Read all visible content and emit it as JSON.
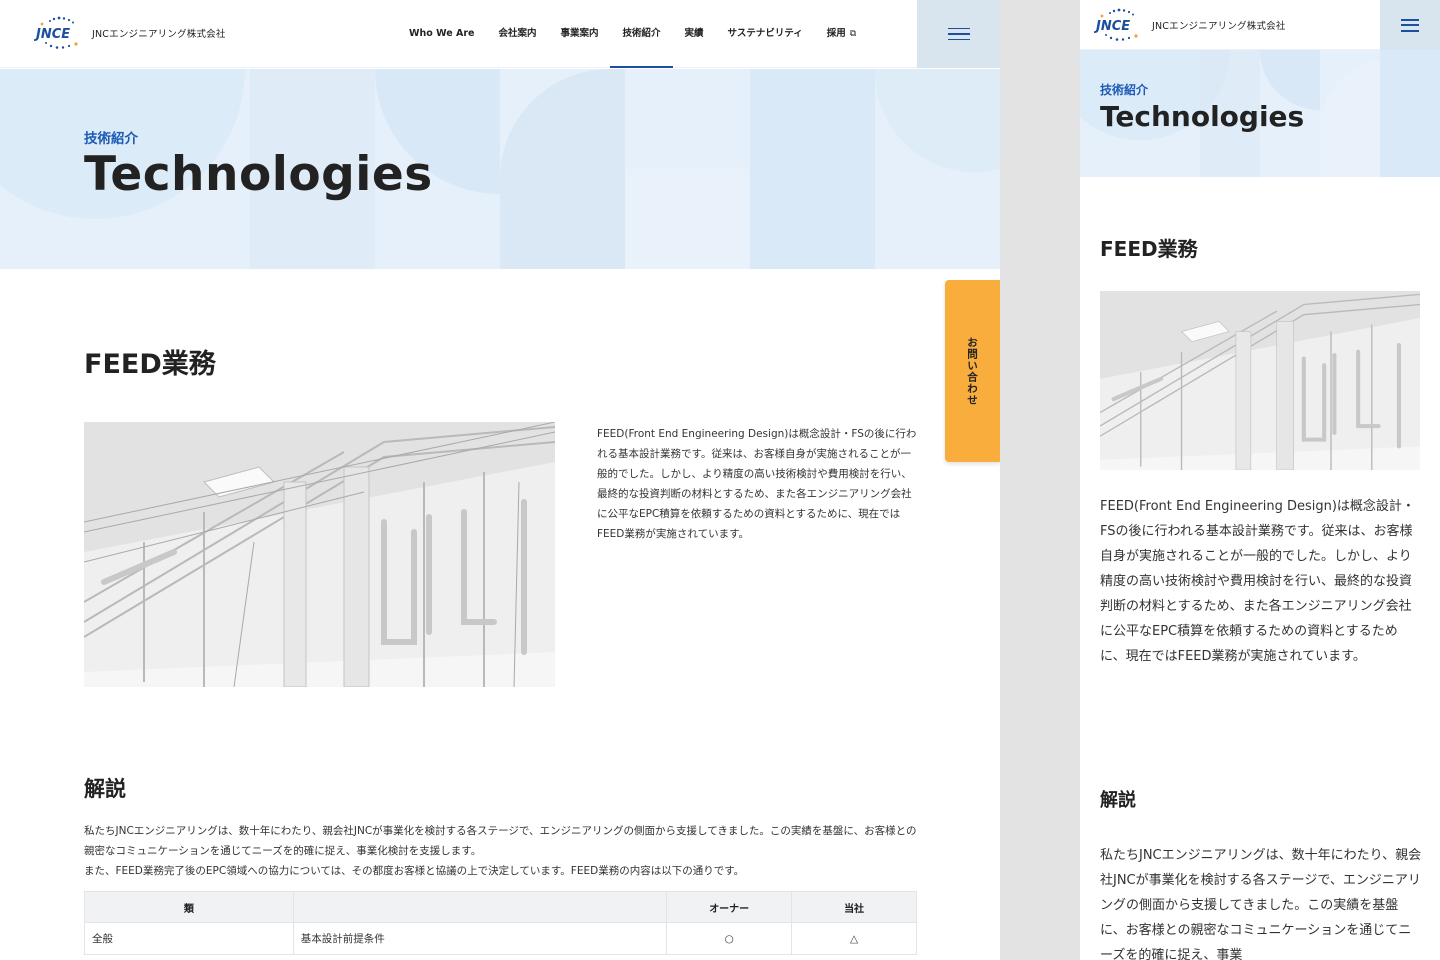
{
  "brand": {
    "company_name": "JNCエンジニアリング株式会社",
    "logo_text": "JNCE",
    "accent_color": "#1c4fa0",
    "hero_bg": "#e5f0fa",
    "contact_color": "#f8ad3d"
  },
  "nav": {
    "items": [
      {
        "label": "Who We Are"
      },
      {
        "label": "会社案内"
      },
      {
        "label": "事業案内"
      },
      {
        "label": "技術紹介",
        "active": true
      },
      {
        "label": "実績"
      },
      {
        "label": "サステナビリティ"
      },
      {
        "label": "採用",
        "icon": "external-link-icon"
      }
    ],
    "menu_icon": "hamburger-menu-icon"
  },
  "hero": {
    "kicker": "技術紹介",
    "title": "Technologies"
  },
  "contact_tab": {
    "label": "お問い合わせ"
  },
  "section": {
    "heading": "FEED業務",
    "paragraph": "FEED(Front End Engineering Design)は概念設計・FSの後に行われる基本設計業務です。従来は、お客様自身が実施されることが一般的でした。しかし、より精度の高い技術検討や費用検討を行い、最終的な投資判断の材料とするため、また各エンジニアリング会社に公平なEPC積算を依頼するための資料とするために、現在ではFEED業務が実施されています。"
  },
  "explanation": {
    "heading": "解説",
    "line1": "私たちJNCエンジニアリングは、数十年にわたり、親会社JNCが事業化を検討する各ステージで、エンジニアリングの側面から支援してきました。この実績を基盤に、お客様との親密なコミュニケーションを通じてニーズを的確に捉え、事業化検討を支援します。",
    "line2": "また、FEED業務完了後のEPC領域への協力については、その都度お客様と協議の上で決定しています。FEED業務の内容は以下の通りです。",
    "mobile_text": "私たちJNCエンジニアリングは、数十年にわたり、親会社JNCが事業化を検討する各ステージで、エンジニアリングの側面から支援してきました。この実績を基盤に、お客様との親密なコミュニケーションを通じてニーズを的確に捉え、事業"
  },
  "table": {
    "headers": [
      "類",
      "",
      "オーナー",
      "当社"
    ],
    "rows": [
      [
        "全般",
        "基本設計前提条件",
        "○",
        "△"
      ]
    ]
  }
}
